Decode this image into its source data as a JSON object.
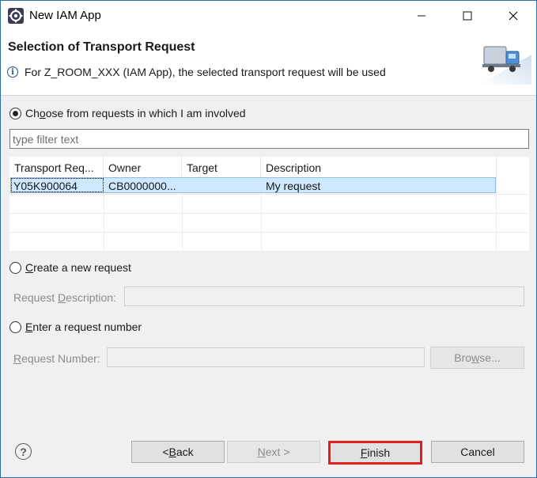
{
  "window": {
    "title": "New IAM App"
  },
  "header": {
    "title": "Selection of Transport Request",
    "message": "For Z_ROOM_XXX (IAM App), the selected transport request will be used"
  },
  "choose_option": {
    "label_pre": "Ch",
    "label_mnemonic": "o",
    "label_post": "ose from requests in which I am involved",
    "selected": true
  },
  "filter": {
    "placeholder": "type filter text",
    "value": ""
  },
  "table": {
    "columns": [
      "Transport Req...",
      "Owner",
      "Target",
      "Description"
    ],
    "rows": [
      {
        "request": "Y05K900064",
        "owner": "CB0000000...",
        "target": "",
        "description": "My request"
      }
    ]
  },
  "create_option": {
    "label_mnemonic": "C",
    "label_post": "reate a new request",
    "selected": false
  },
  "request_description": {
    "label_pre": "Request ",
    "label_mnemonic": "D",
    "label_post": "escription:",
    "value": ""
  },
  "enter_option": {
    "label_mnemonic": "E",
    "label_post": "nter a request number",
    "selected": false
  },
  "request_number": {
    "label_mnemonic": "R",
    "label_post": "equest Number:",
    "value": ""
  },
  "buttons": {
    "browse_pre": "Bro",
    "browse_mnemonic": "w",
    "browse_post": "se...",
    "back_pre": "< ",
    "back_mnemonic": "B",
    "back_post": "ack",
    "next_mnemonic": "N",
    "next_post": "ext >",
    "finish_mnemonic": "F",
    "finish_post": "inish",
    "cancel": "Cancel"
  },
  "icons": {
    "app": "eclipse-gear-icon",
    "info": "info-icon",
    "truck": "transport-truck-icon",
    "help": "help-icon"
  },
  "colors": {
    "selection": "#cde8ff",
    "finish_highlight": "#e11d1d"
  }
}
